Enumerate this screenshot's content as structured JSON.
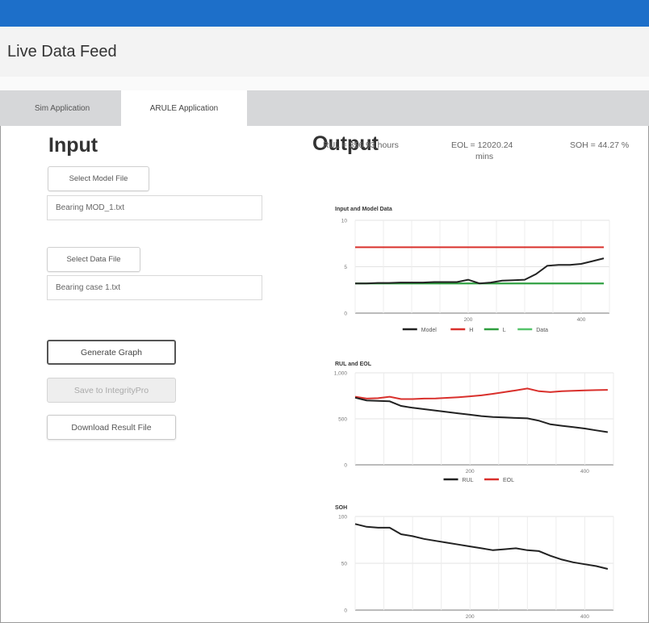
{
  "app": {
    "title": "Live Data Feed"
  },
  "tabs": [
    {
      "label": "Sim Application",
      "active": false
    },
    {
      "label": "ARULE Application",
      "active": true
    }
  ],
  "input": {
    "heading": "Input",
    "select_model_label": "Select Model File",
    "model_file_value": "Bearing MOD_1.txt",
    "select_data_label": "Select Data File",
    "data_file_value": "Bearing case 1.txt",
    "generate_label": "Generate Graph",
    "save_label": "Save to IntegrityPro",
    "download_label": "Download Result File"
  },
  "output": {
    "heading": "Output",
    "rul": "RUL = 356.93 hours",
    "eol_line1": "EOL = 12020.24",
    "eol_line2": "mins",
    "soh": "SOH = 44.27 %"
  },
  "colors": {
    "accent_bar": "#1d6fc9",
    "model": "#222222",
    "h": "#d9302c",
    "l": "#2e9e3f",
    "data": "#55c46a"
  },
  "chart_data": [
    {
      "type": "line",
      "title": "Input and Model Data",
      "x": [
        0,
        20,
        40,
        60,
        80,
        100,
        120,
        140,
        160,
        180,
        200,
        220,
        240,
        260,
        280,
        300,
        320,
        340,
        360,
        380,
        400,
        420,
        440
      ],
      "xlim": [
        0,
        450
      ],
      "ylim": [
        0,
        10
      ],
      "y_ticks": [
        "0",
        "5",
        "10"
      ],
      "x_ticks": [
        "200",
        "400"
      ],
      "legend_position": "bottom",
      "grid": true,
      "series": [
        {
          "name": "Model",
          "color": "#222222",
          "values": [
            3.2,
            3.2,
            3.25,
            3.25,
            3.3,
            3.3,
            3.3,
            3.35,
            3.35,
            3.35,
            3.6,
            3.2,
            3.3,
            3.5,
            3.55,
            3.6,
            4.2,
            5.1,
            5.2,
            5.2,
            5.3,
            5.6,
            5.9
          ]
        },
        {
          "name": "H",
          "color": "#d9302c",
          "values": [
            7.1,
            7.1,
            7.1,
            7.1,
            7.1,
            7.1,
            7.1,
            7.1,
            7.1,
            7.1,
            7.1,
            7.1,
            7.1,
            7.1,
            7.1,
            7.1,
            7.1,
            7.1,
            7.1,
            7.1,
            7.1,
            7.1,
            7.1
          ]
        },
        {
          "name": "L",
          "color": "#2e9e3f",
          "values": [
            3.2,
            3.2,
            3.2,
            3.2,
            3.2,
            3.2,
            3.2,
            3.2,
            3.2,
            3.2,
            3.2,
            3.2,
            3.2,
            3.2,
            3.2,
            3.2,
            3.2,
            3.2,
            3.2,
            3.2,
            3.2,
            3.2,
            3.2
          ]
        },
        {
          "name": "Data",
          "color": "#55c46a",
          "values": [
            3.2,
            3.2,
            3.2,
            3.2,
            3.2,
            3.2,
            3.2,
            3.2,
            3.2,
            3.2,
            3.2,
            3.2,
            3.2,
            3.2,
            3.2,
            3.2,
            3.2,
            3.2,
            3.2,
            3.2,
            3.2,
            3.2,
            3.2
          ]
        }
      ]
    },
    {
      "type": "line",
      "title": "RUL and EOL",
      "x": [
        0,
        20,
        40,
        60,
        80,
        100,
        120,
        140,
        160,
        180,
        200,
        220,
        240,
        260,
        280,
        300,
        320,
        340,
        360,
        380,
        400,
        420,
        440
      ],
      "xlim": [
        0,
        450
      ],
      "ylim": [
        0,
        1000
      ],
      "y_ticks": [
        "0",
        "500",
        "1,000"
      ],
      "x_ticks": [
        "200",
        "400"
      ],
      "legend_position": "bottom",
      "grid": true,
      "series": [
        {
          "name": "RUL",
          "color": "#222222",
          "values": [
            730,
            700,
            695,
            690,
            640,
            620,
            605,
            590,
            575,
            560,
            545,
            530,
            520,
            515,
            510,
            505,
            480,
            440,
            425,
            410,
            395,
            375,
            355
          ]
        },
        {
          "name": "EOL",
          "color": "#d9302c",
          "values": [
            740,
            720,
            725,
            740,
            715,
            715,
            720,
            722,
            728,
            735,
            745,
            755,
            772,
            790,
            810,
            830,
            800,
            790,
            800,
            805,
            810,
            812,
            815
          ]
        }
      ]
    },
    {
      "type": "line",
      "title": "SOH",
      "x": [
        0,
        20,
        40,
        60,
        80,
        100,
        120,
        140,
        160,
        180,
        200,
        220,
        240,
        260,
        280,
        300,
        320,
        340,
        360,
        380,
        400,
        420,
        440
      ],
      "xlim": [
        0,
        450
      ],
      "ylim": [
        0,
        100
      ],
      "y_ticks": [
        "0",
        "50",
        "100"
      ],
      "x_ticks": [
        "200",
        "400"
      ],
      "grid": true,
      "series": [
        {
          "name": "SOH",
          "color": "#222222",
          "values": [
            92,
            89,
            88,
            88,
            81,
            79,
            76,
            74,
            72,
            70,
            68,
            66,
            64,
            65,
            66,
            64,
            63,
            58,
            54,
            51,
            49,
            47,
            44
          ]
        }
      ]
    }
  ]
}
